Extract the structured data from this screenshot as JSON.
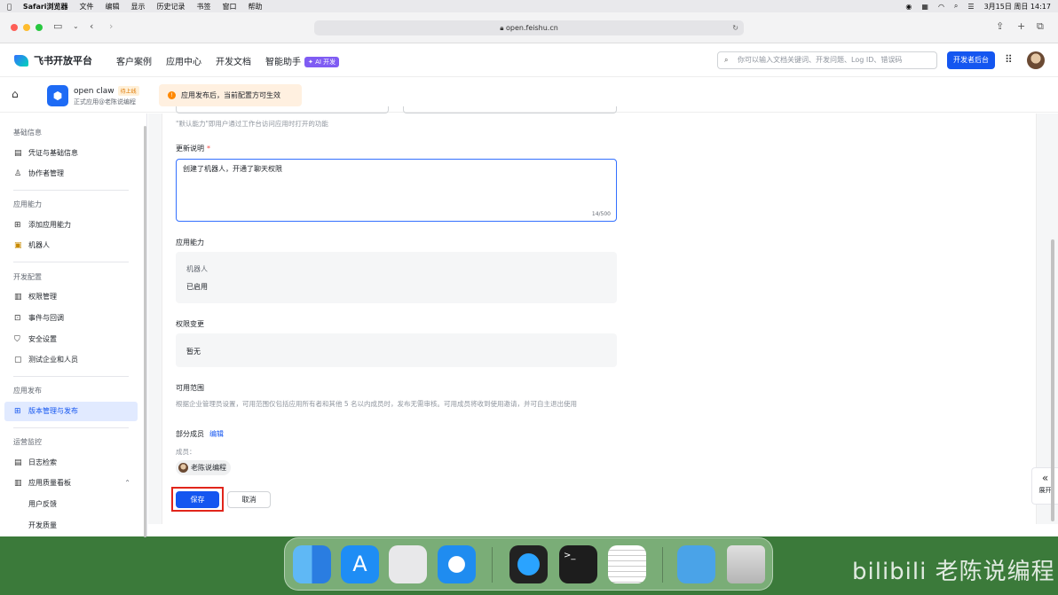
{
  "menubar": {
    "app": "Safari浏览器",
    "items": [
      "文件",
      "编辑",
      "显示",
      "历史记录",
      "书签",
      "窗口",
      "帮助"
    ],
    "datetime": "3月15日 周日 14:17"
  },
  "browser": {
    "url": "open.feishu.cn"
  },
  "nav": {
    "brand": "飞书开放平台",
    "links": [
      "客户案例",
      "应用中心",
      "开发文档",
      "智能助手"
    ],
    "ai_badge": "✦ AI 开发",
    "search_placeholder": "你可以输入文档关键词、开发问题、Log ID、错误码",
    "dev_console": "开发者后台"
  },
  "app_header": {
    "name": "open claw",
    "status": "待上线",
    "subtitle": "正式应用@老陈说编程",
    "notice": "应用发布后，当前配置方可生效"
  },
  "sidebar": {
    "groups": {
      "basic": "基础信息",
      "capability": "应用能力",
      "dev_config": "开发配置",
      "publish": "应用发布",
      "ops": "运营监控"
    },
    "items": {
      "credentials": "凭证与基础信息",
      "collaborators": "协作者管理",
      "add_capability": "添加应用能力",
      "bot": "机器人",
      "permissions": "权限管理",
      "events": "事件与回调",
      "security": "安全设置",
      "test_enterprise": "测试企业和人员",
      "versions": "版本管理与发布",
      "logs": "日志检索",
      "quality": "应用质量看板",
      "feedback": "用户反馈",
      "dev_quality": "开发质量"
    }
  },
  "form": {
    "default_hint": "\"默认能力\"即用户通过工作台访问应用时打开的功能",
    "update_notes_label": "更新说明",
    "required_mark": "*",
    "update_notes_value": "创建了机器人，开通了聊天权限",
    "char_count": "14/500",
    "capability_label": "应用能力",
    "capability_name": "机器人",
    "capability_status": "已启用",
    "permission_label": "权限变更",
    "permission_value": "暂无",
    "scope_label": "可用范围",
    "scope_desc": "根据企业管理员设置，可用范围仅包括应用所有者和其他 5 名以内成员时，发布无需审核。可用成员将收到使用邀请，并可自主退出使用",
    "scope_value": "部分成员",
    "edit_link": "编辑",
    "members_label": "成员：",
    "member_name": "老陈说编程",
    "save": "保存",
    "cancel": "取消"
  },
  "expand_label": "展开",
  "watermark": "老陈说编程",
  "colors": {
    "primary": "#1456f0",
    "highlight": "#e1251b",
    "notice_bg": "#fff0e0"
  }
}
